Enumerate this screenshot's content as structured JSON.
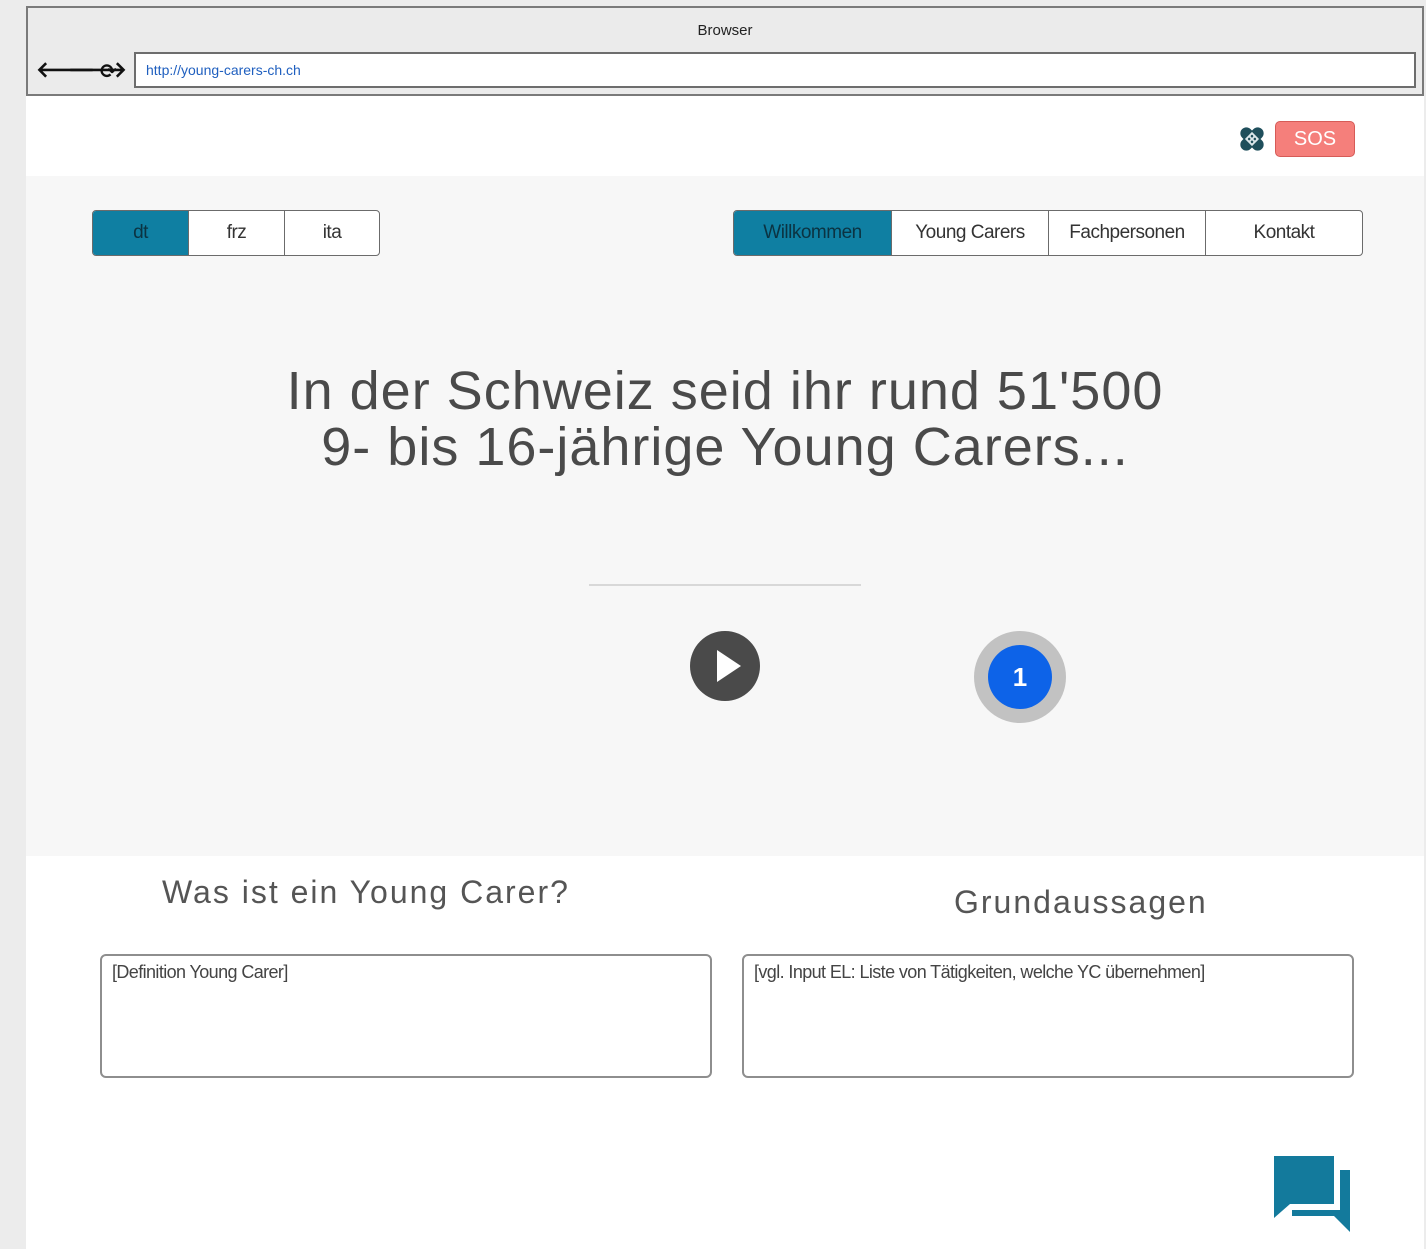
{
  "browser": {
    "title": "Browser",
    "url": "http://young-carers-ch.ch",
    "nav": {
      "back": "🡐",
      "forward": "🡒",
      "reload": "⟳"
    }
  },
  "utility": {
    "sos_icon": "bandage-icon",
    "sos_label": "SOS",
    "sos_color": "#f57f7b"
  },
  "languages": {
    "items": [
      {
        "label": "dt",
        "active": true
      },
      {
        "label": "frz",
        "active": false
      },
      {
        "label": "ita",
        "active": false
      }
    ]
  },
  "menu": {
    "items": [
      {
        "label": "Willkommen",
        "active": true
      },
      {
        "label": "Young Carers",
        "active": false
      },
      {
        "label": "Fachpersonen",
        "active": false
      },
      {
        "label": "Kontakt",
        "active": false
      }
    ],
    "accent_color": "#0f7fa2"
  },
  "hero": {
    "headline_line1": "In der Schweiz seid ihr rund 51'500",
    "headline_line2": "9- bis 16-jährige Young Carers...",
    "play_icon": "play-icon",
    "slide_number": "1"
  },
  "sections": {
    "left_title": "Was ist ein Young Carer?",
    "left_body": "[Definition Young Carer]",
    "right_title": "Grundaussagen",
    "right_body": "[vgl. Input EL: Liste von Tätigkeiten, welche YC übernehmen]"
  },
  "chat": {
    "icon": "chat-icon",
    "color": "#137a9c"
  }
}
